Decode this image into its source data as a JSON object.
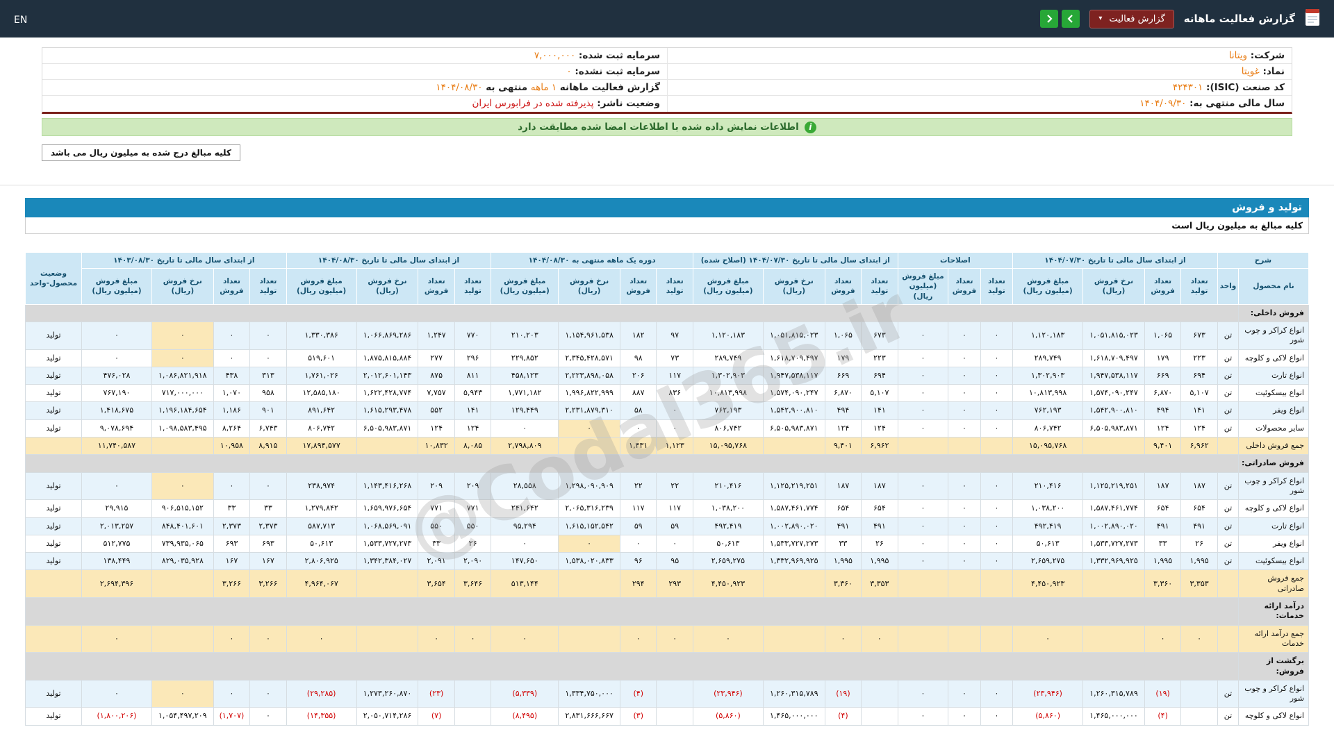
{
  "topbar": {
    "en_label": "EN",
    "title": "گزارش فعالیت ماهانه",
    "report_dropdown": {
      "label": "گزارش فعالیت",
      "caret": "▾"
    },
    "nav": {
      "left_icon": "chevron-left",
      "right_icon": "chevron-right"
    },
    "accent_green": "#27a737",
    "accent_maroon": "#7e2220"
  },
  "company_info": {
    "right_rows": [
      [
        {
          "t": "شرکت:  ",
          "c": "lbl"
        },
        {
          "t": "ویتانا",
          "c": "org"
        }
      ],
      [
        {
          "t": "نماد:  ",
          "c": "lbl"
        },
        {
          "t": "غویتا",
          "c": "org"
        }
      ],
      [
        {
          "t": "کد صنعت (ISIC):  ",
          "c": "lbl"
        },
        {
          "t": "۴۲۴۳۰۱",
          "c": "org"
        }
      ],
      [
        {
          "t": "سال مالی منتهی به:  ",
          "c": "lbl"
        },
        {
          "t": "۱۴۰۴/۰۹/۳۰",
          "c": "org"
        }
      ]
    ],
    "left_rows": [
      [
        {
          "t": "سرمایه ثبت شده:  ",
          "c": "lbl"
        },
        {
          "t": "۷,۰۰۰,۰۰۰",
          "c": "org"
        }
      ],
      [
        {
          "t": "سرمایه ثبت نشده:  ",
          "c": "lbl"
        },
        {
          "t": "۰",
          "c": "org"
        }
      ],
      [
        {
          "t": "گزارش فعالیت ماهانه ",
          "c": "lbl"
        },
        {
          "t": "۱ ماهه",
          "c": "org"
        },
        {
          "t": " منتهی به ",
          "c": "lbl"
        },
        {
          "t": "۱۴۰۴/۰۸/۳۰",
          "c": "org"
        }
      ],
      [
        {
          "t": "وضعیت ناشر:  ",
          "c": "lbl"
        },
        {
          "t": "پذیرفته شده در فرابورس ایران",
          "c": "red"
        }
      ]
    ]
  },
  "banner": {
    "icon": "i",
    "text": "اطلاعات نمایش داده شده با اطلاعات امضا شده مطابقت دارد"
  },
  "units_note": "کلیه مبالغ درج شده به میلیون ریال می باشد",
  "section": {
    "title": "تولید و فروش",
    "amounts_note": "کلیه مبالغ به میلیون ریال است"
  },
  "watermark": "@Codal365.ir",
  "table": {
    "header": {
      "sharh": "شرح",
      "name_col": "نام محصول",
      "unit_col": "واحد",
      "status_col": "وضعیت محصول-واحد",
      "groups": [
        {
          "label": "از ابتدای سال مالی تا تاریخ ۱۴۰۴/۰۷/۳۰",
          "cols": [
            "تعداد تولید",
            "تعداد فروش",
            "نرخ فروش (ریال)",
            "مبلغ فروش (میلیون ریال)"
          ]
        },
        {
          "label": "اصلاحات",
          "cols": [
            "تعداد تولید",
            "تعداد فروش",
            "مبلغ فروش (میلیون ریال)"
          ]
        },
        {
          "label": "از ابتدای سال مالی تا تاریخ ۱۴۰۴/۰۷/۳۰ (اصلاح شده)",
          "cols": [
            "تعداد تولید",
            "تعداد فروش",
            "نرخ فروش (ریال)",
            "مبلغ فروش (میلیون ریال)"
          ]
        },
        {
          "label": "دوره یک ماهه منتهی به ۱۴۰۴/۰۸/۳۰",
          "cols": [
            "تعداد تولید",
            "تعداد فروش",
            "نرخ فروش (ریال)",
            "مبلغ فروش (میلیون ریال)"
          ]
        },
        {
          "label": "از ابتدای سال مالی تا تاریخ ۱۴۰۴/۰۸/۳۰",
          "cols": [
            "تعداد تولید",
            "تعداد فروش",
            "نرخ فروش (ریال)",
            "مبلغ فروش (میلیون ریال)"
          ]
        },
        {
          "label": "از ابتدای سال مالی تا تاریخ ۱۴۰۳/۰۸/۳۰",
          "cols": [
            "تعداد تولید",
            "تعداد فروش",
            "نرخ فروش (ریال)",
            "مبلغ فروش (میلیون ریال)"
          ]
        }
      ]
    },
    "rows": [
      {
        "type": "section",
        "name": "فروش داخلی:"
      },
      {
        "type": "data",
        "shade": true,
        "name": "انواع کراکر و چوب شور",
        "unit": "تن",
        "status": "تولید",
        "ylw": [
          21
        ],
        "cells": [
          "۶۷۳",
          "۱,۰۶۵",
          "۱,۰۵۱,۸۱۵,۰۲۳",
          "۱,۱۲۰,۱۸۳",
          "۰",
          "۰",
          "۰",
          "۶۷۳",
          "۱,۰۶۵",
          "۱,۰۵۱,۸۱۵,۰۲۳",
          "۱,۱۲۰,۱۸۳",
          "۹۷",
          "۱۸۲",
          "۱,۱۵۴,۹۶۱,۵۳۸",
          "۲۱۰,۲۰۳",
          "۷۷۰",
          "۱,۲۴۷",
          "۱,۰۶۶,۸۶۹,۲۸۶",
          "۱,۳۳۰,۳۸۶",
          "۰",
          "۰",
          "۰",
          "۰"
        ]
      },
      {
        "type": "data",
        "shade": false,
        "name": "انواع لاکی و کلوچه",
        "unit": "تن",
        "status": "تولید",
        "ylw": [
          21
        ],
        "cells": [
          "۲۲۳",
          "۱۷۹",
          "۱,۶۱۸,۷۰۹,۴۹۷",
          "۲۸۹,۷۴۹",
          "۰",
          "۰",
          "۰",
          "۲۲۳",
          "۱۷۹",
          "۱,۶۱۸,۷۰۹,۴۹۷",
          "۲۸۹,۷۴۹",
          "۷۳",
          "۹۸",
          "۲,۳۴۵,۴۲۸,۵۷۱",
          "۲۲۹,۸۵۲",
          "۲۹۶",
          "۲۷۷",
          "۱,۸۷۵,۸۱۵,۸۸۴",
          "۵۱۹,۶۰۱",
          "۰",
          "۰",
          "۰",
          "۰"
        ]
      },
      {
        "type": "data",
        "shade": true,
        "name": "انواع تارت",
        "unit": "تن",
        "status": "تولید",
        "ylw": [],
        "cells": [
          "۶۹۴",
          "۶۶۹",
          "۱,۹۴۷,۵۳۸,۱۱۷",
          "۱,۳۰۲,۹۰۳",
          "۰",
          "۰",
          "۰",
          "۶۹۴",
          "۶۶۹",
          "۱,۹۴۷,۵۳۸,۱۱۷",
          "۱,۳۰۲,۹۰۳",
          "۱۱۷",
          "۲۰۶",
          "۲,۲۲۳,۸۹۸,۰۵۸",
          "۴۵۸,۱۲۳",
          "۸۱۱",
          "۸۷۵",
          "۲,۰۱۲,۶۰۱,۱۴۳",
          "۱,۷۶۱,۰۲۶",
          "۳۱۳",
          "۴۳۸",
          "۱,۰۸۶,۸۲۱,۹۱۸",
          "۴۷۶,۰۲۸"
        ]
      },
      {
        "type": "data",
        "shade": false,
        "name": "انواع بیسکوئیت",
        "unit": "تن",
        "status": "تولید",
        "ylw": [],
        "cells": [
          "۵,۱۰۷",
          "۶,۸۷۰",
          "۱,۵۷۴,۰۹۰,۲۴۷",
          "۱۰,۸۱۳,۹۹۸",
          "۰",
          "۰",
          "۰",
          "۵,۱۰۷",
          "۶,۸۷۰",
          "۱,۵۷۴,۰۹۰,۲۴۷",
          "۱۰,۸۱۳,۹۹۸",
          "۸۳۶",
          "۸۸۷",
          "۱,۹۹۶,۸۲۲,۹۹۹",
          "۱,۷۷۱,۱۸۲",
          "۵,۹۴۳",
          "۷,۷۵۷",
          "۱,۶۲۲,۴۲۸,۷۷۴",
          "۱۲,۵۸۵,۱۸۰",
          "۹۵۸",
          "۱,۰۷۰",
          "۷۱۷,۰۰۰,۰۰۰",
          "۷۶۷,۱۹۰"
        ]
      },
      {
        "type": "data",
        "shade": true,
        "name": "انواع ویفر",
        "unit": "تن",
        "status": "تولید",
        "ylw": [],
        "cells": [
          "۱۴۱",
          "۴۹۴",
          "۱,۵۴۲,۹۰۰,۸۱۰",
          "۷۶۲,۱۹۳",
          "۰",
          "۰",
          "۰",
          "۱۴۱",
          "۴۹۴",
          "۱,۵۴۲,۹۰۰,۸۱۰",
          "۷۶۲,۱۹۳",
          "۰",
          "۵۸",
          "۲,۲۳۱,۸۷۹,۳۱۰",
          "۱۲۹,۴۴۹",
          "۱۴۱",
          "۵۵۲",
          "۱,۶۱۵,۲۹۳,۴۷۸",
          "۸۹۱,۶۴۲",
          "۹۰۱",
          "۱,۱۸۶",
          "۱,۱۹۶,۱۸۴,۶۵۴",
          "۱,۴۱۸,۶۷۵"
        ]
      },
      {
        "type": "data",
        "shade": false,
        "name": "سایر محصولات",
        "unit": "تن",
        "status": "تولید",
        "ylw": [
          13
        ],
        "cells": [
          "۱۲۴",
          "۱۲۴",
          "۶,۵۰۵,۹۸۳,۸۷۱",
          "۸۰۶,۷۴۲",
          "۰",
          "۰",
          "۰",
          "۱۲۴",
          "۱۲۴",
          "۶,۵۰۵,۹۸۳,۸۷۱",
          "۸۰۶,۷۴۲",
          "۰",
          "۰",
          "۰",
          "۰",
          "۱۲۴",
          "۱۲۴",
          "۶,۵۰۵,۹۸۳,۸۷۱",
          "۸۰۶,۷۴۲",
          "۶,۷۴۳",
          "۸,۲۶۴",
          "۱,۰۹۸,۵۸۳,۴۹۵",
          "۹,۰۷۸,۶۹۴"
        ]
      },
      {
        "type": "total",
        "name": "جمع فروش داخلی",
        "unit": "",
        "status": "",
        "ylw": [],
        "cells": [
          "۶,۹۶۲",
          "۹,۴۰۱",
          "",
          "۱۵,۰۹۵,۷۶۸",
          "",
          "",
          "",
          "۶,۹۶۲",
          "۹,۴۰۱",
          "",
          "۱۵,۰۹۵,۷۶۸",
          "۱,۱۲۳",
          "۱,۴۳۱",
          "",
          "۲,۷۹۸,۸۰۹",
          "۸,۰۸۵",
          "۱۰,۸۳۲",
          "",
          "۱۷,۸۹۴,۵۷۷",
          "۸,۹۱۵",
          "۱۰,۹۵۸",
          "",
          "۱۱,۷۴۰,۵۸۷"
        ]
      },
      {
        "type": "section",
        "name": "فروش صادراتی:"
      },
      {
        "type": "data",
        "shade": true,
        "name": "انواع کراکر و چوب شور",
        "unit": "تن",
        "status": "تولید",
        "ylw": [
          21
        ],
        "cells": [
          "۱۸۷",
          "۱۸۷",
          "۱,۱۲۵,۲۱۹,۲۵۱",
          "۲۱۰,۴۱۶",
          "۰",
          "۰",
          "۰",
          "۱۸۷",
          "۱۸۷",
          "۱,۱۲۵,۲۱۹,۲۵۱",
          "۲۱۰,۴۱۶",
          "۲۲",
          "۲۲",
          "۱,۲۹۸,۰۹۰,۹۰۹",
          "۲۸,۵۵۸",
          "۲۰۹",
          "۲۰۹",
          "۱,۱۴۳,۴۱۶,۲۶۸",
          "۲۳۸,۹۷۴",
          "۰",
          "۰",
          "۰",
          "۰"
        ]
      },
      {
        "type": "data",
        "shade": false,
        "name": "انواع لاکی و کلوچه",
        "unit": "تن",
        "status": "تولید",
        "ylw": [],
        "cells": [
          "۶۵۴",
          "۶۵۴",
          "۱,۵۸۷,۴۶۱,۷۷۴",
          "۱,۰۳۸,۲۰۰",
          "۰",
          "۰",
          "۰",
          "۶۵۴",
          "۶۵۴",
          "۱,۵۸۷,۴۶۱,۷۷۴",
          "۱,۰۳۸,۲۰۰",
          "۱۱۷",
          "۱۱۷",
          "۲,۰۶۵,۳۱۶,۲۳۹",
          "۲۴۱,۶۴۲",
          "۷۷۱",
          "۷۷۱",
          "۱,۶۵۹,۹۷۶,۶۵۴",
          "۱,۲۷۹,۸۴۲",
          "۳۳",
          "۳۳",
          "۹۰۶,۵۱۵,۱۵۲",
          "۲۹,۹۱۵"
        ]
      },
      {
        "type": "data",
        "shade": true,
        "name": "انواع تارت",
        "unit": "تن",
        "status": "تولید",
        "ylw": [],
        "cells": [
          "۴۹۱",
          "۴۹۱",
          "۱,۰۰۲,۸۹۰,۰۲۰",
          "۴۹۲,۴۱۹",
          "۰",
          "۰",
          "۰",
          "۴۹۱",
          "۴۹۱",
          "۱,۰۰۲,۸۹۰,۰۲۰",
          "۴۹۲,۴۱۹",
          "۵۹",
          "۵۹",
          "۱,۶۱۵,۱۵۲,۵۴۲",
          "۹۵,۲۹۴",
          "۵۵۰",
          "۵۵۰",
          "۱,۰۶۸,۵۶۹,۰۹۱",
          "۵۸۷,۷۱۳",
          "۲,۳۷۳",
          "۲,۳۷۳",
          "۸۴۸,۴۰۱,۶۰۱",
          "۲,۰۱۳,۲۵۷"
        ]
      },
      {
        "type": "data",
        "shade": false,
        "name": "انواع ویفر",
        "unit": "تن",
        "status": "تولید",
        "ylw": [
          13
        ],
        "cells": [
          "۲۶",
          "۳۳",
          "۱,۵۳۳,۷۲۷,۲۷۳",
          "۵۰,۶۱۳",
          "۰",
          "۰",
          "۰",
          "۲۶",
          "۳۳",
          "۱,۵۳۳,۷۲۷,۲۷۳",
          "۵۰,۶۱۳",
          "۰",
          "۰",
          "۰",
          "۰",
          "۲۶",
          "۳۳",
          "۱,۵۳۳,۷۲۷,۲۷۳",
          "۵۰,۶۱۳",
          "۶۹۳",
          "۶۹۳",
          "۷۳۹,۹۳۵,۰۶۵",
          "۵۱۲,۷۷۵"
        ]
      },
      {
        "type": "data",
        "shade": true,
        "name": "انواع بیسکوئیت",
        "unit": "تن",
        "status": "تولید",
        "ylw": [],
        "cells": [
          "۱,۹۹۵",
          "۱,۹۹۵",
          "۱,۳۳۲,۹۶۹,۹۲۵",
          "۲,۶۵۹,۲۷۵",
          "۰",
          "۰",
          "۰",
          "۱,۹۹۵",
          "۱,۹۹۵",
          "۱,۳۳۲,۹۶۹,۹۲۵",
          "۲,۶۵۹,۲۷۵",
          "۹۵",
          "۹۶",
          "۱,۵۳۸,۰۲۰,۸۳۳",
          "۱۴۷,۶۵۰",
          "۲,۰۹۰",
          "۲,۰۹۱",
          "۱,۳۴۲,۳۸۴,۰۲۷",
          "۲,۸۰۶,۹۲۵",
          "۱۶۷",
          "۱۶۷",
          "۸۲۹,۰۳۵,۹۲۸",
          "۱۳۸,۴۴۹"
        ]
      },
      {
        "type": "total",
        "name": "جمع فروش صادراتی",
        "unit": "",
        "status": "",
        "ylw": [],
        "cells": [
          "۳,۳۵۳",
          "۳,۳۶۰",
          "",
          "۴,۴۵۰,۹۲۳",
          "",
          "",
          "",
          "۳,۳۵۳",
          "۳,۳۶۰",
          "",
          "۴,۴۵۰,۹۲۳",
          "۲۹۳",
          "۲۹۴",
          "",
          "۵۱۳,۱۴۴",
          "۳,۶۴۶",
          "۳,۶۵۴",
          "",
          "۴,۹۶۴,۰۶۷",
          "۳,۲۶۶",
          "۳,۲۶۶",
          "",
          "۲,۶۹۴,۳۹۶"
        ]
      },
      {
        "type": "section",
        "name": "درآمد ارائه خدمات:"
      },
      {
        "type": "total",
        "name": "جمع درآمد ارائه خدمات",
        "unit": "",
        "status": "",
        "ylw": [],
        "cells": [
          "۰",
          "۰",
          "",
          "۰",
          "",
          "",
          "",
          "۰",
          "۰",
          "",
          "۰",
          "۰",
          "۰",
          "",
          "۰",
          "۰",
          "۰",
          "",
          "۰",
          "۰",
          "۰",
          "",
          "۰"
        ]
      },
      {
        "type": "section",
        "name": "برگشت از فروش:"
      },
      {
        "type": "data",
        "shade": true,
        "name": "انواع کراکر و چوب شور",
        "unit": "تن",
        "status": "تولید",
        "ylw": [
          21
        ],
        "cells": [
          "",
          "(۱۹)",
          "۱,۲۶۰,۳۱۵,۷۸۹",
          "(۲۳,۹۴۶)",
          "۰",
          "۰",
          "۰",
          "",
          "(۱۹)",
          "۱,۲۶۰,۳۱۵,۷۸۹",
          "(۲۳,۹۴۶)",
          "",
          "(۴)",
          "۱,۳۳۴,۷۵۰,۰۰۰",
          "(۵,۳۳۹)",
          "",
          "(۲۳)",
          "۱,۲۷۳,۲۶۰,۸۷۰",
          "(۲۹,۲۸۵)",
          "۰",
          "۰",
          "۰",
          "۰"
        ]
      },
      {
        "type": "data",
        "shade": false,
        "name": "انواع لاکی و کلوچه",
        "unit": "تن",
        "status": "تولید",
        "ylw": [],
        "cells": [
          "",
          "(۴)",
          "۱,۴۶۵,۰۰۰,۰۰۰",
          "(۵,۸۶۰)",
          "۰",
          "۰",
          "۰",
          "",
          "(۴)",
          "۱,۴۶۵,۰۰۰,۰۰۰",
          "(۵,۸۶۰)",
          "",
          "(۳)",
          "۲,۸۳۱,۶۶۶,۶۶۷",
          "(۸,۴۹۵)",
          "",
          "(۷)",
          "۲,۰۵۰,۷۱۴,۲۸۶",
          "(۱۴,۳۵۵)",
          "۰",
          "(۱,۷۰۷)",
          "۱,۰۵۴,۴۹۷,۲۰۹",
          "(۱,۸۰۰,۲۰۶)"
        ]
      }
    ]
  }
}
